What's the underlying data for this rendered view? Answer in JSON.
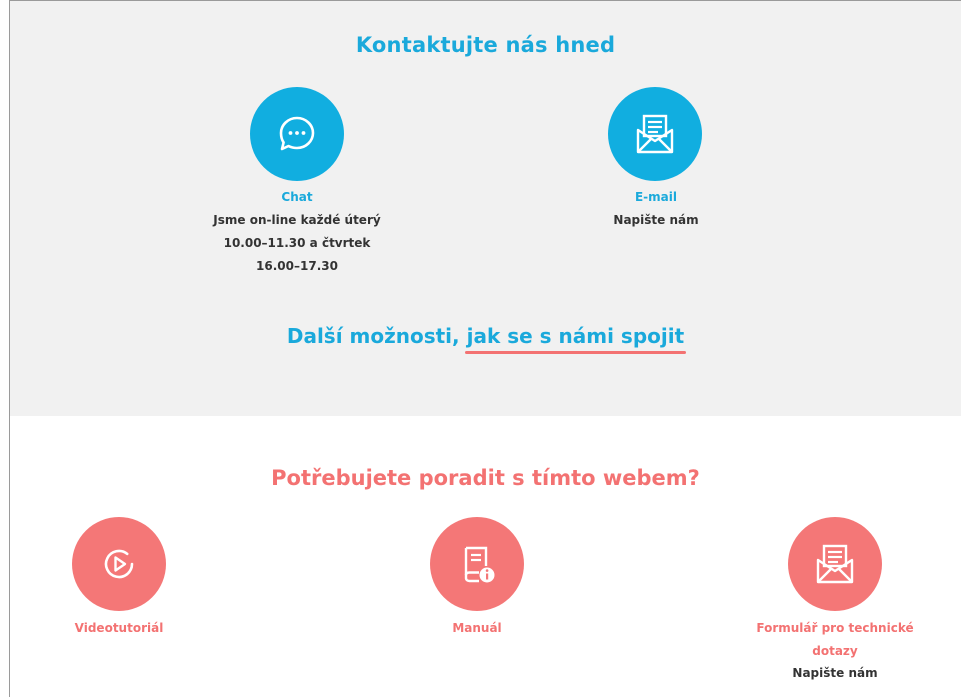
{
  "contact": {
    "title": "Kontaktujte nás hned",
    "chat": {
      "label": "Chat",
      "line1": "Jsme on-line každé úterý",
      "line2": "10.00–11.30 a čtvrtek",
      "line3": "16.00–17.30",
      "icon": "chat-bubble-icon"
    },
    "email": {
      "label": "E-mail",
      "desc": "Napište nám",
      "icon": "envelope-icon"
    },
    "more_prefix": "Další možnosti, ",
    "more_link": "jak se s námi spojit"
  },
  "help": {
    "title": "Potřebujete poradit s tímto webem?",
    "video": {
      "label": "Videotutoriál",
      "icon": "play-icon"
    },
    "manual": {
      "label": "Manuál",
      "icon": "manual-book-icon"
    },
    "form": {
      "label_line1": "Formulář pro technické",
      "label_line2": "dotazy",
      "desc": "Napište nám",
      "icon": "envelope-icon"
    }
  },
  "colors": {
    "blue": "#11aee0",
    "red": "#f47777",
    "top_background": "#f1f1f1"
  }
}
